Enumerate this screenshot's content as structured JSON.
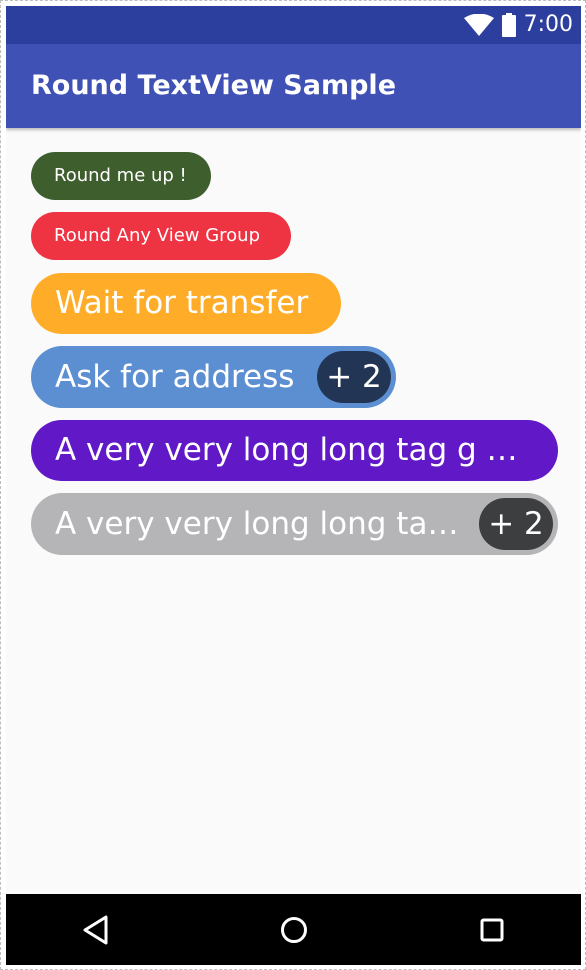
{
  "status_bar": {
    "time": "7:00",
    "icons": [
      "wifi-icon",
      "battery-icon"
    ],
    "color": "#2d3f9e"
  },
  "app_bar": {
    "title": "Round TextView Sample",
    "color": "#3f51b5"
  },
  "tags": [
    {
      "label": "Round me up !",
      "color": "#3f5e2e"
    },
    {
      "label": "Round Any View Group",
      "color": "#ee3342"
    },
    {
      "label": "Wait for transfer",
      "color": "#ffad28"
    },
    {
      "label": "Ask for address",
      "badge": "+ 2",
      "color": "#5b8fd1",
      "badge_color": "#233554"
    },
    {
      "label": "A very very long long tag g g…",
      "color": "#6119c7"
    },
    {
      "label": "A very very long long ta…",
      "badge": "+ 2",
      "color": "#b5b5b8",
      "badge_color": "#3d3e40"
    }
  ],
  "nav_bar": {
    "icons": [
      "back-icon",
      "home-icon",
      "recent-apps-icon"
    ]
  }
}
